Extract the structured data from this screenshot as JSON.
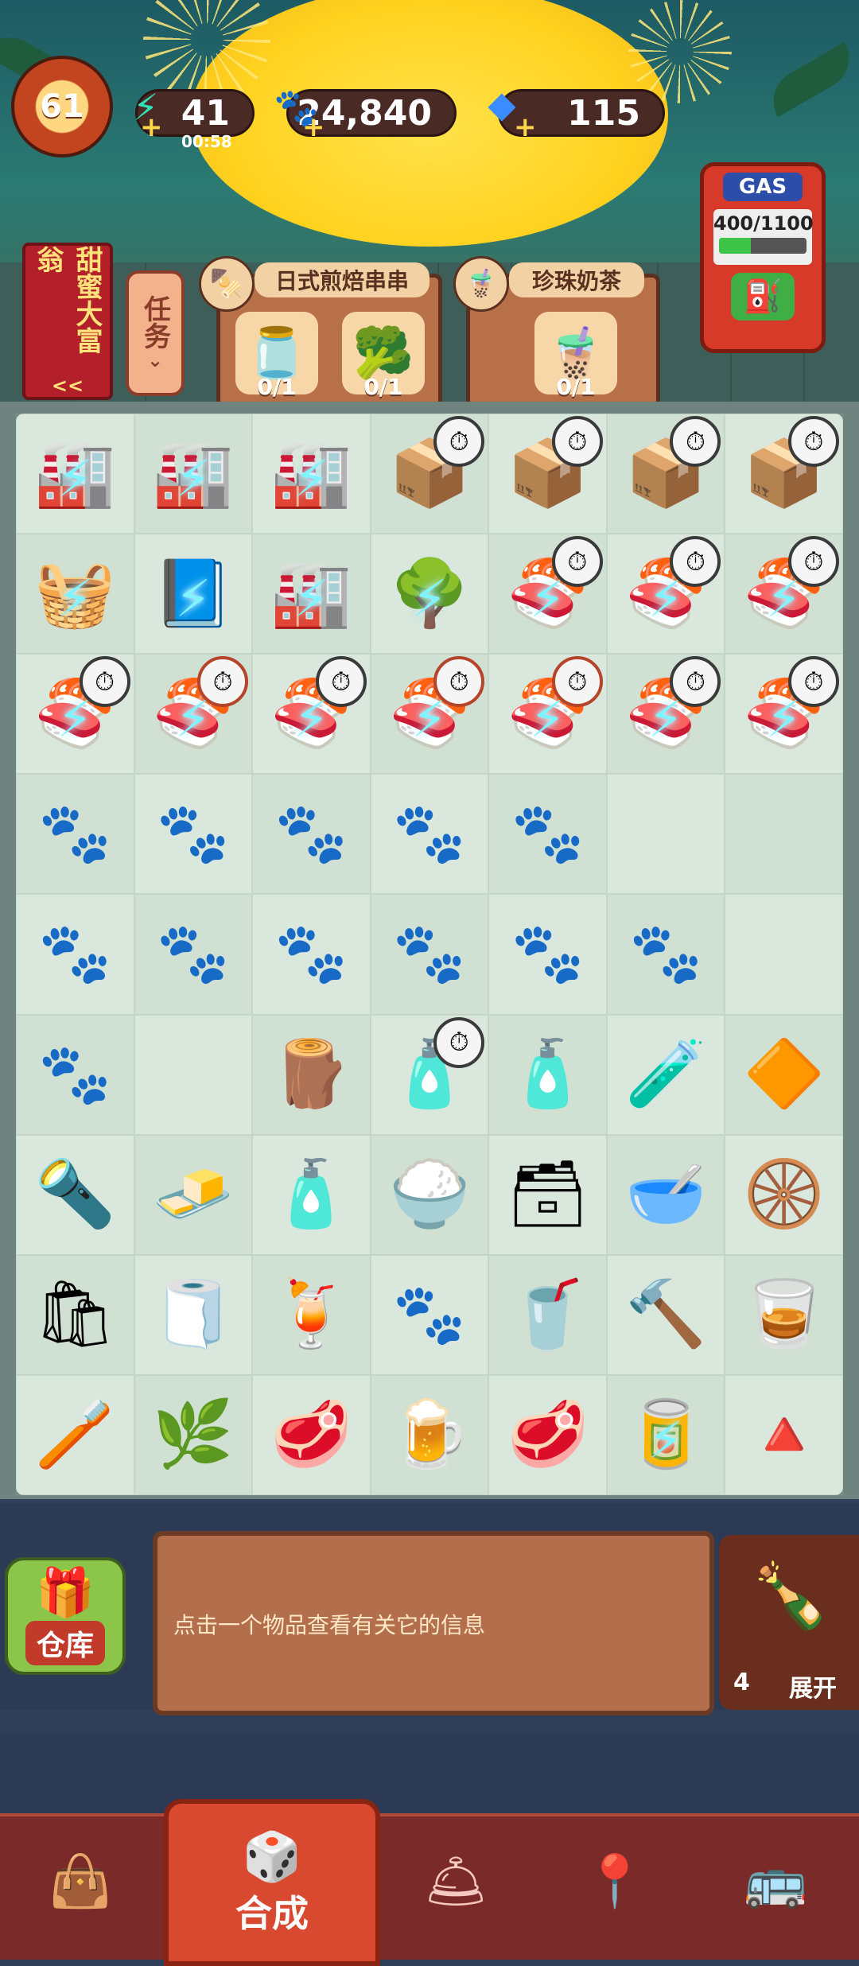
{
  "hud": {
    "level": "61",
    "energy": "41",
    "energy_timer": "00:58",
    "coins": "24,840",
    "gems": "115"
  },
  "side": {
    "tycoon_label": "甜蜜大富翁",
    "tycoon_arrows": "<<",
    "tasks_label": "任务"
  },
  "orders": [
    {
      "title": "日式煎焙串串",
      "items": [
        {
          "icon": "jam-jar-icon",
          "count": "0/1"
        },
        {
          "icon": "broccoli-icon",
          "count": "0/1"
        }
      ]
    },
    {
      "title": "珍珠奶茶",
      "items": [
        {
          "icon": "bubble-tea-icon",
          "count": "0/1"
        }
      ]
    }
  ],
  "gas": {
    "label": "GAS",
    "value": "400/1100"
  },
  "board": [
    [
      "machine",
      "machine",
      "machine",
      "drone",
      "drone",
      "drone",
      "drone"
    ],
    [
      "tree-machine",
      "book",
      "machine",
      "tree",
      "sushi",
      "sushi",
      "sushi"
    ],
    [
      "sushi",
      "sushi",
      "sushi",
      "sushi",
      "sushi",
      "sushi",
      "sushi"
    ],
    [
      "paw",
      "paw2",
      "paw",
      "paw",
      "paw",
      "",
      ""
    ],
    [
      "paw2",
      "paw2",
      "paw",
      "paw2",
      "paw2",
      "paw",
      ""
    ],
    [
      "paw2",
      "",
      "stamps",
      "ink",
      "ink",
      "bottles",
      "crystal"
    ],
    [
      "gadget",
      "gold",
      "bottle",
      "rice",
      "box",
      "bowl",
      "tire"
    ],
    [
      "bag",
      "towel",
      "mug",
      "paw3",
      "drink",
      "hammer",
      "glass"
    ],
    [
      "brush",
      "herbs",
      "meat",
      "beer",
      "meat",
      "can",
      "triangle"
    ]
  ],
  "info": {
    "message": "点击一个物品查看有关它的信息",
    "expand_count": "4",
    "expand_label": "展开"
  },
  "warehouse_label": "仓库",
  "nav": {
    "merge_label": "合成"
  }
}
